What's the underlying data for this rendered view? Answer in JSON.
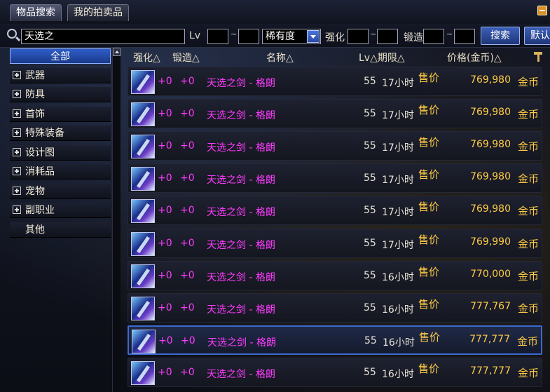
{
  "tabs": [
    {
      "label": "物品搜索"
    },
    {
      "label": "我的拍卖品"
    }
  ],
  "search": {
    "keyword": "天选之",
    "lv_label": "Lv",
    "lv_from": "",
    "lv_to": "",
    "tilde": "~",
    "rarity_selected": "稀有度",
    "enhance_label": "强化",
    "enhance_from": "",
    "enhance_to": "",
    "forge_label": "锻造",
    "forge_from": "",
    "forge_to": "",
    "search_button": "搜索",
    "default_button": "默认"
  },
  "categories": [
    {
      "label": "全部",
      "expandable": false,
      "active": true
    },
    {
      "label": "武器",
      "expandable": true
    },
    {
      "label": "防具",
      "expandable": true
    },
    {
      "label": "首饰",
      "expandable": true
    },
    {
      "label": "特殊装备",
      "expandable": true
    },
    {
      "label": "设计图",
      "expandable": true
    },
    {
      "label": "消耗品",
      "expandable": true
    },
    {
      "label": "宠物",
      "expandable": true
    },
    {
      "label": "副职业",
      "expandable": true
    },
    {
      "label": "其他",
      "expandable": false
    }
  ],
  "columns": {
    "enhance": "强化△",
    "forge": "锻造△",
    "name": "名称△",
    "lv_period": "Lv△期限△",
    "price": "价格(金币)△"
  },
  "rows": [
    {
      "enhance": "+0",
      "forge": "+0",
      "name": "天选之剑 - 格朗",
      "lv": "55",
      "period": "17小时",
      "sale": "售价",
      "price": "769,980",
      "currency": "金币"
    },
    {
      "enhance": "+0",
      "forge": "+0",
      "name": "天选之剑 - 格朗",
      "lv": "55",
      "period": "17小时",
      "sale": "售价",
      "price": "769,980",
      "currency": "金币"
    },
    {
      "enhance": "+0",
      "forge": "+0",
      "name": "天选之剑 - 格朗",
      "lv": "55",
      "period": "17小时",
      "sale": "售价",
      "price": "769,980",
      "currency": "金币"
    },
    {
      "enhance": "+0",
      "forge": "+0",
      "name": "天选之剑 - 格朗",
      "lv": "55",
      "period": "17小时",
      "sale": "售价",
      "price": "769,980",
      "currency": "金币"
    },
    {
      "enhance": "+0",
      "forge": "+0",
      "name": "天选之剑 - 格朗",
      "lv": "55",
      "period": "17小时",
      "sale": "售价",
      "price": "769,980",
      "currency": "金币"
    },
    {
      "enhance": "+0",
      "forge": "+0",
      "name": "天选之剑 - 格朗",
      "lv": "55",
      "period": "17小时",
      "sale": "售价",
      "price": "769,990",
      "currency": "金币"
    },
    {
      "enhance": "+0",
      "forge": "+0",
      "name": "天选之剑 - 格朗",
      "lv": "55",
      "period": "16小时",
      "sale": "售价",
      "price": "770,000",
      "currency": "金币"
    },
    {
      "enhance": "+0",
      "forge": "+0",
      "name": "天选之剑 - 格朗",
      "lv": "55",
      "period": "16小时",
      "sale": "售价",
      "price": "777,767",
      "currency": "金币"
    },
    {
      "enhance": "+0",
      "forge": "+0",
      "name": "天选之剑 - 格朗",
      "lv": "55",
      "period": "16小时",
      "sale": "售价",
      "price": "777,777",
      "currency": "金币",
      "selected": true
    },
    {
      "enhance": "+0",
      "forge": "+0",
      "name": "天选之剑 - 格朗",
      "lv": "55",
      "period": "16小时",
      "sale": "售价",
      "price": "777,777",
      "currency": "金币"
    }
  ],
  "colors": {
    "accent_blue": "#3a6ad0",
    "price_gold": "#ffcc44",
    "name_magenta": "#ff3cff"
  },
  "icons": {
    "search": "magnifier-icon",
    "item": "sword-item-icon",
    "repair": "hammer-icon",
    "close": "window-corner-icon"
  }
}
